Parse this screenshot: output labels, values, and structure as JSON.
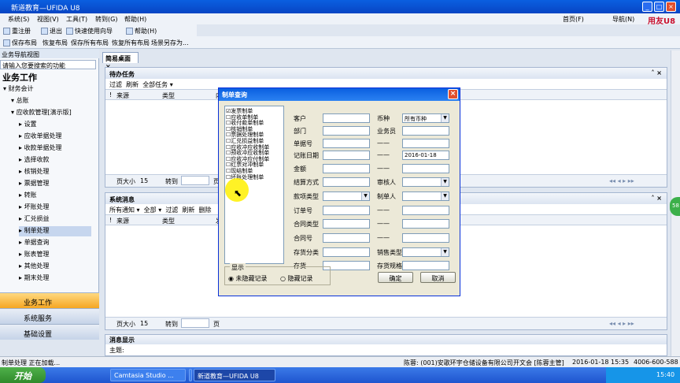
{
  "window": {
    "title": "新道教育—UFIDA U8",
    "logo": "用友U8"
  },
  "menu": [
    "系统(S)",
    "视图(V)",
    "工具(T)",
    "转到(G)",
    "帮助(H)"
  ],
  "topright": {
    "home": "首页(F)",
    "nav": "导航(N)"
  },
  "toolbar1": [
    "重注册",
    "退出",
    "快速使用向导",
    "帮助(H)"
  ],
  "toolbar2": [
    "保存布局",
    "恢复布局",
    "保存所有布局",
    "恢复所有布局",
    "场景另存为..."
  ],
  "left": {
    "header": "业务导航视图",
    "search_placeholder": "请输入您要搜索的功能",
    "title": "业务工作",
    "tree": [
      {
        "label": "财务会计",
        "level": 0
      },
      {
        "label": "总账",
        "level": 1
      },
      {
        "label": "应收款管理[演示版]",
        "level": 1
      },
      {
        "label": "设置",
        "level": 2
      },
      {
        "label": "应收单据处理",
        "level": 2
      },
      {
        "label": "收款单据处理",
        "level": 2
      },
      {
        "label": "选择收款",
        "level": 2
      },
      {
        "label": "核销处理",
        "level": 2
      },
      {
        "label": "票据管理",
        "level": 2
      },
      {
        "label": "转账",
        "level": 2
      },
      {
        "label": "坏账处理",
        "level": 2
      },
      {
        "label": "汇兑损益",
        "level": 2
      },
      {
        "label": "制单处理",
        "level": 2,
        "selected": true
      },
      {
        "label": "单据查询",
        "level": 2
      },
      {
        "label": "账表管理",
        "level": 2
      },
      {
        "label": "其他处理",
        "level": 2
      },
      {
        "label": "期末处理",
        "level": 2
      }
    ],
    "nav": [
      "业务工作",
      "系统服务",
      "基础设置"
    ]
  },
  "tab": {
    "label": "简易桌面"
  },
  "todo": {
    "title": "待办任务",
    "toolbar": [
      "过滤",
      "刷新",
      "全部任务 ▾"
    ],
    "cols": [
      "!",
      "来源",
      "类型",
      "内"
    ],
    "page_size_label": "页大小",
    "page_size": "15",
    "goto": "转到",
    "page": "页"
  },
  "messages": {
    "title": "系统消息",
    "toolbar": [
      "所有通知 ▾",
      "全部 ▾",
      "过滤",
      "刷新",
      "删除"
    ],
    "cols": [
      "!",
      "来源",
      "类型",
      "发"
    ],
    "page_size_label": "页大小",
    "page_size": "15",
    "goto": "转到",
    "page": "页"
  },
  "msgdisplay": {
    "title": "消息显示",
    "subject_label": "主题:"
  },
  "dialog": {
    "title": "制单查询",
    "list": [
      {
        "label": "发票制单",
        "checked": true
      },
      {
        "label": "应收单制单",
        "checked": false
      },
      {
        "label": "收付款单制单",
        "checked": false
      },
      {
        "label": "核销制单",
        "checked": false
      },
      {
        "label": "票据处理制单",
        "checked": false
      },
      {
        "label": "汇兑损益制单",
        "checked": false
      },
      {
        "label": "应收冲应收制单",
        "checked": false
      },
      {
        "label": "预收冲应收制单",
        "checked": false
      },
      {
        "label": "应收冲应付制单",
        "checked": false
      },
      {
        "label": "红票对冲制单",
        "checked": false
      },
      {
        "label": "现结制单",
        "checked": false
      },
      {
        "label": "坏账处理制单",
        "checked": false
      }
    ],
    "fields_left": [
      "客户",
      "部门",
      "单据号",
      "记账日期",
      "金额",
      "结算方式",
      "款项类型",
      "订单号",
      "合同类型",
      "合同号",
      "存货分类",
      "存货"
    ],
    "fields_right": [
      "币种",
      "业务员",
      "",
      "",
      "",
      "审核人",
      "制单人",
      "",
      "",
      "",
      "销售类型",
      "存货规格"
    ],
    "currency": "所有币种",
    "date_to": "2016-01-18",
    "dash": "——",
    "display_label": "显示",
    "radio_unhidden": "未隐藏记录",
    "radio_hidden": "隐藏记录",
    "ok": "确定",
    "cancel": "取消"
  },
  "status": {
    "left": "制单处理 正在加载...",
    "user": "陈蓉: (001)安歌环宇仓储设备有限公司",
    "right": "开文会 [陈蓉主管]",
    "date": "2016-01-18 15:35",
    "phone": "4006-600-588"
  },
  "taskbar": {
    "start": "开始",
    "items": [
      "Camtasia Studio ...",
      "",
      "新道教育—UFIDA U8"
    ],
    "time": "15:40"
  }
}
